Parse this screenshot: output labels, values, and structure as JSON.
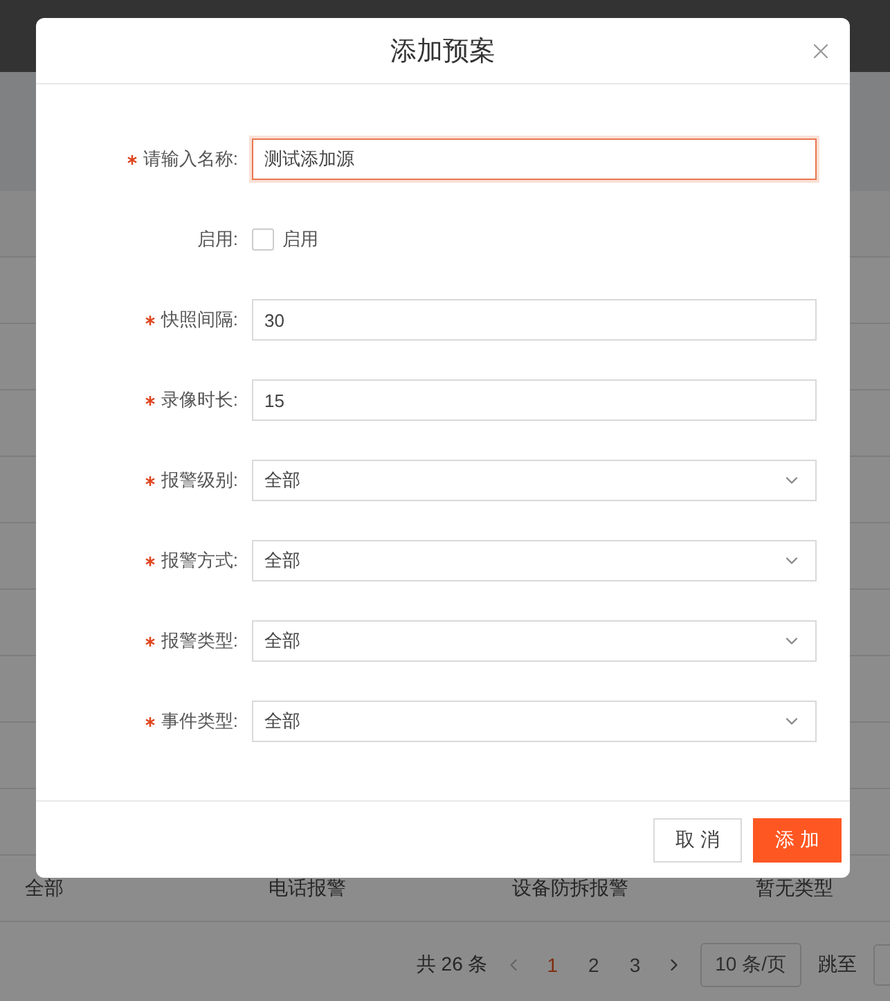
{
  "background": {
    "rows": [
      [
        "全部",
        "电话报警",
        "设备防拆报警",
        "暂无类型"
      ]
    ],
    "pagination": {
      "total": "共 26 条",
      "pages": [
        {
          "label": "1",
          "selected": true
        },
        {
          "label": "2",
          "selected": false
        },
        {
          "label": "3",
          "selected": false
        }
      ],
      "page_size": "10 条/页",
      "jump_label": "跳至"
    }
  },
  "dialog": {
    "title": "添加预案",
    "fields": [
      {
        "kind": "input",
        "label": "请输入名称:",
        "required": true,
        "value": "测试添加源",
        "focused": true
      },
      {
        "kind": "checkbox",
        "label": "启用:",
        "required": false,
        "option": "启用",
        "checked": false
      },
      {
        "kind": "input",
        "label": "快照间隔:",
        "required": true,
        "value": "30",
        "focused": false
      },
      {
        "kind": "input",
        "label": "录像时长:",
        "required": true,
        "value": "15",
        "focused": false
      },
      {
        "kind": "select",
        "label": "报警级别:",
        "required": true,
        "value": "全部"
      },
      {
        "kind": "select",
        "label": "报警方式:",
        "required": true,
        "value": "全部"
      },
      {
        "kind": "select",
        "label": "报警类型:",
        "required": true,
        "value": "全部"
      },
      {
        "kind": "select",
        "label": "事件类型:",
        "required": true,
        "value": "全部"
      }
    ],
    "buttons": [
      {
        "kind": "secondary",
        "label": "取 消"
      },
      {
        "kind": "primary",
        "label": "添 加"
      }
    ]
  }
}
